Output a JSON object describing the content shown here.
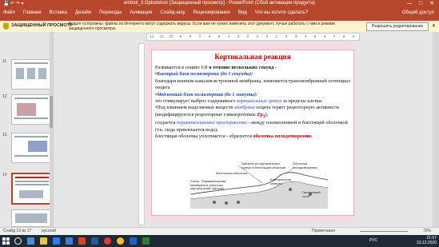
{
  "window": {
    "title": "embiol_3.Oplodotvor [Защищенный просмотр] - PowerPoint (Сбой активации продукта)",
    "user": "Общий доступ",
    "controls": [
      "—",
      "□",
      "✕"
    ]
  },
  "ribbon": {
    "tabs": [
      "Файл",
      "Главная",
      "Вставка",
      "Дизайн",
      "Переходы",
      "Анимация",
      "Слайд-шоу",
      "Рецензирование",
      "Вид",
      "Что вы хотите сделать?"
    ],
    "share": "Общий доступ"
  },
  "message_bar": {
    "label": "ЗАЩИЩЕННЫЙ ПРОСМОТР",
    "text": "Будьте осторожны: файлы из Интернета могут содержать вирусы. Если вам не нужно изменять этот документ, лучше работать с ним в режиме защищенного просмотра.",
    "button": "Разрешить редактирование"
  },
  "thumbnails": [
    {
      "number": "11"
    },
    {
      "number": "12"
    },
    {
      "number": "13"
    },
    {
      "number": "14"
    }
  ],
  "ruler": [
    "12",
    "11",
    "10",
    "9",
    "8",
    "7",
    "6",
    "5",
    "4",
    "3",
    "2",
    "1",
    "0",
    "1",
    "2",
    "3",
    "4",
    "5",
    "6",
    "7",
    "8",
    "9",
    "10",
    "11",
    "12"
  ],
  "slide": {
    "title": "Кортикальная реакция",
    "line1_a": "Развивается в ооците I-II ",
    "line1_b": "в течение нескольких секунд",
    "line1_c": " -",
    "p2_a": "•Быстрый блок полиспермии (до 1 секунды):",
    "p2_b": "благодаря ионным каналам встроенной мембраны, изменяется трансмембранный потенциал ооцита",
    "p3_a": "•Медленный блок полиспермии (до 1 минуты):",
    "p3_b": "это стимулирует выброс содержимого ",
    "p3_c": "кортикальных гранул",
    "p3_d": " за пределы клетки.",
    "p4_a": "•Под влиянием выделяемых веществ ",
    "p4_b": "мембрана",
    "p4_c": " ооцита теряет рецепторную активность (модифицируются рецепторные гликопротеины ",
    "p4_d": "Zp",
    "p4_e": "3",
    "p4_f": ");",
    "p5_a": "создается ",
    "p5_b": "перивителлиновое пространство",
    "p5_c": " - между плазмолеммой и блестящей оболочкой (т.к. сюда привлекается вода),",
    "p6_a": "блестящая оболочка уплотняется - образуется ",
    "p6_b": "оболочка оплодотворения",
    "p6_c": ".",
    "diagram": {
      "cap1": "Гранулы из кортикальных гранул в блестящей оболочке",
      "cap2": "Желточная оболочка",
      "cap3": "Оболочка оплодотворения",
      "cap4": "Кортикальная гранула",
      "cap5": "Слить. Плазматическая мембрана и оболочка кортикальной гранулы",
      "cap6": "Гиалиновый слой"
    }
  },
  "status": {
    "slide": "Слайд 13 из 17",
    "lang": "русский",
    "notes": "Примечания",
    "zoom": "72%"
  },
  "taskbar": {
    "lang": "РУС",
    "time": "21:57",
    "date": "23.12.2020"
  },
  "colors": {
    "accent": "#b7472a",
    "title_red": "#c00000",
    "blue": "#1f3fbf"
  }
}
